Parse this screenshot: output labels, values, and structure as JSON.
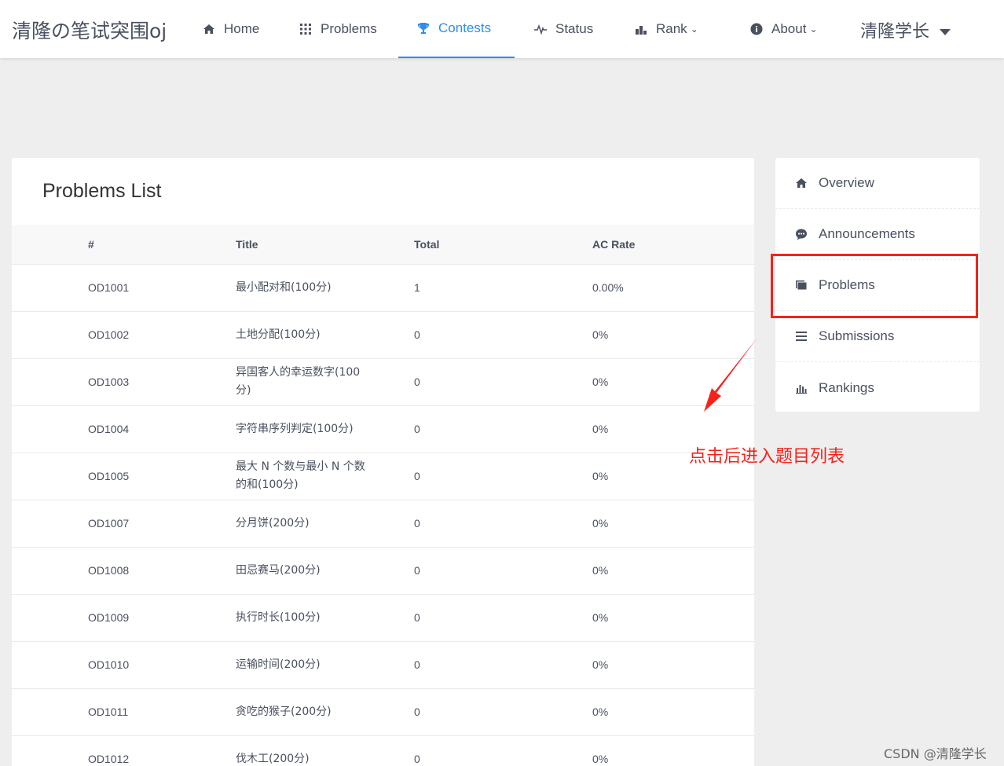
{
  "header": {
    "logo": "清隆の笔试突围oj",
    "nav": [
      {
        "label": "Home",
        "icon": "home-icon"
      },
      {
        "label": "Problems",
        "icon": "grid-icon"
      },
      {
        "label": "Contests",
        "icon": "trophy-icon",
        "active": true
      },
      {
        "label": "Status",
        "icon": "pulse-icon"
      },
      {
        "label": "Rank",
        "icon": "bar-chart-icon",
        "dropdown": true
      },
      {
        "label": "About",
        "icon": "info-icon",
        "dropdown": true
      }
    ],
    "user": "清隆学长"
  },
  "main": {
    "title": "Problems List",
    "columns": [
      "#",
      "Title",
      "Total",
      "AC Rate"
    ],
    "rows": [
      {
        "id": "OD1001",
        "title": "最小配对和(100分)",
        "total": "1",
        "ac_rate": "0.00%"
      },
      {
        "id": "OD1002",
        "title": "土地分配(100分)",
        "total": "0",
        "ac_rate": "0%"
      },
      {
        "id": "OD1003",
        "title": "异国客人的幸运数字(100分)",
        "total": "0",
        "ac_rate": "0%"
      },
      {
        "id": "OD1004",
        "title": "字符串序列判定(100分)",
        "total": "0",
        "ac_rate": "0%"
      },
      {
        "id": "OD1005",
        "title": "最大 N 个数与最小 N 个数的和(100分)",
        "total": "0",
        "ac_rate": "0%"
      },
      {
        "id": "OD1007",
        "title": "分月饼(200分)",
        "total": "0",
        "ac_rate": "0%"
      },
      {
        "id": "OD1008",
        "title": "田忌赛马(200分)",
        "total": "0",
        "ac_rate": "0%"
      },
      {
        "id": "OD1009",
        "title": "执行时长(100分)",
        "total": "0",
        "ac_rate": "0%"
      },
      {
        "id": "OD1010",
        "title": "运输时间(200分)",
        "total": "0",
        "ac_rate": "0%"
      },
      {
        "id": "OD1011",
        "title": "贪吃的猴子(200分)",
        "total": "0",
        "ac_rate": "0%"
      },
      {
        "id": "OD1012",
        "title": "伐木工(200分)",
        "total": "0",
        "ac_rate": "0%"
      }
    ]
  },
  "sidebar": {
    "items": [
      {
        "label": "Overview",
        "icon": "home-icon"
      },
      {
        "label": "Announcements",
        "icon": "chat-icon"
      },
      {
        "label": "Problems",
        "icon": "folders-icon"
      },
      {
        "label": "Submissions",
        "icon": "list-icon"
      },
      {
        "label": "Rankings",
        "icon": "bar-chart-icon"
      }
    ]
  },
  "annotation": "点击后进入题目列表",
  "watermark": "CSDN @清隆学长",
  "colors": {
    "accent": "#2d8cf0",
    "annotation": "#f5221a",
    "background": "#eeeeee"
  }
}
